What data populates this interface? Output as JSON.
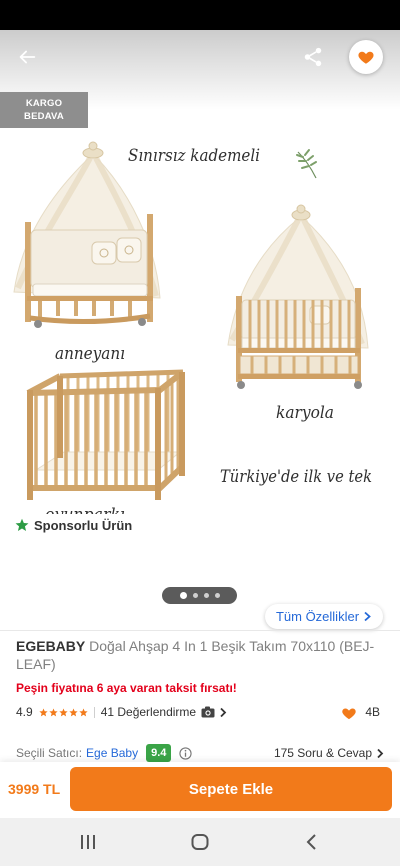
{
  "colors": {
    "accent": "#f27a1a",
    "promo_red": "#e3001b",
    "link_blue": "#2569d8",
    "seller_green": "#3aa447",
    "sponsor_green": "#2d9c45",
    "badge_grey": "#8e8e8e"
  },
  "header": {
    "back_icon": "arrow-left-icon",
    "share_icon": "share-icon",
    "favorite_icon": "heart-icon"
  },
  "shipping_badge": {
    "line1": "KARGO",
    "line2": "BEDAVA"
  },
  "product_image": {
    "captions": [
      "Sınırsız kademeli",
      "anneyanı",
      "karyola",
      "Türkiye'de ilk ve tek",
      "oyunparkı"
    ],
    "decor_icon": "leaf-icon"
  },
  "sponsored": {
    "icon": "star-icon",
    "label": "Sponsorlu Ürün"
  },
  "carousel": {
    "total": 4,
    "active_index": 0
  },
  "features_link": {
    "label": "Tüm Özellikler",
    "icon": "chevron-right-icon"
  },
  "product": {
    "brand": "EGEBABY",
    "name": "Doğal Ahşap 4 In 1 Beşik Takım 70x110 (BEJ-LEAF)"
  },
  "promo": {
    "text": "Peşin fiyatına 6 aya varan taksit fırsatı!"
  },
  "rating": {
    "score": "4.9",
    "stars": 5,
    "reviews": "41 Değerlendirme",
    "review_icon": "camera-icon",
    "favorites_icon": "heart-icon",
    "favorites": "4B"
  },
  "seller": {
    "label": "Seçili Satıcı:",
    "name": "Ege Baby",
    "score": "9.4",
    "info_icon": "info-icon",
    "qa": "175 Soru & Cevap"
  },
  "cart": {
    "price": "3999 TL",
    "button": "Sepete Ekle"
  },
  "system_nav": {
    "recents_icon": "recent-apps-icon",
    "home_icon": "home-icon",
    "back_icon": "back-icon"
  }
}
